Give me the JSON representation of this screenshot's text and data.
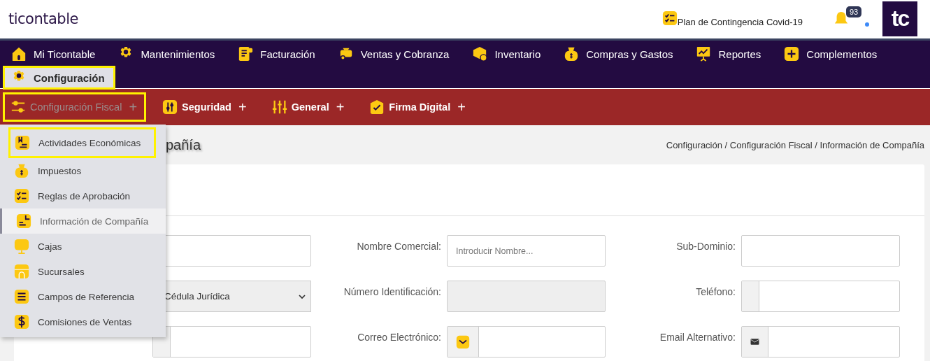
{
  "header": {
    "logo": "ticontable",
    "announcement": "Plan de Contingencia Covid-19",
    "notifications": "93",
    "brand_mark": "tc"
  },
  "main_menu": [
    {
      "label": "Mi Ticontable",
      "selected": false
    },
    {
      "label": "Mantenimientos",
      "selected": false
    },
    {
      "label": "Facturación",
      "selected": false
    },
    {
      "label": "Ventas y Cobranza",
      "selected": false
    },
    {
      "label": "Inventario",
      "selected": false
    },
    {
      "label": "Compras y Gastos",
      "selected": false
    },
    {
      "label": "Reportes",
      "selected": false
    },
    {
      "label": "Complementos",
      "selected": false
    },
    {
      "label": "Configuración",
      "selected": true
    }
  ],
  "sub_menu": [
    {
      "label": "Configuración Fiscal",
      "expander": "+",
      "selected": true
    },
    {
      "label": "Seguridad",
      "expander": "+",
      "selected": false
    },
    {
      "label": "General",
      "expander": "+",
      "selected": false
    },
    {
      "label": "Firma Digital",
      "expander": "+",
      "selected": false
    }
  ],
  "dropdown": [
    {
      "label": "Actividades Económicas",
      "highlighted": true,
      "selected": false
    },
    {
      "label": "Impuestos",
      "highlighted": false,
      "selected": false
    },
    {
      "label": "Reglas de Aprobación",
      "highlighted": false,
      "selected": false
    },
    {
      "label": "Información de Compañía",
      "highlighted": false,
      "selected": true
    },
    {
      "label": "Cajas",
      "highlighted": false,
      "selected": false
    },
    {
      "label": "Sucursales",
      "highlighted": false,
      "selected": false
    },
    {
      "label": "Campos de Referencia",
      "highlighted": false,
      "selected": false
    },
    {
      "label": "Comisiones de Ventas",
      "highlighted": false,
      "selected": false
    }
  ],
  "page": {
    "title": "pañía",
    "breadcrumb": "Configuración / Configuración Fiscal / Información de Compañía"
  },
  "form": {
    "rows": [
      [
        {
          "kind": "text"
        },
        {
          "label": "Nombre Comercial:",
          "kind": "text",
          "placeholder": "Introducir Nombre..."
        },
        {
          "label": "Sub-Dominio:",
          "kind": "text"
        }
      ],
      [
        {
          "kind": "select",
          "value": "Cédula Jurídica"
        },
        {
          "label": "Número Identificación:",
          "kind": "text",
          "disabled": true
        },
        {
          "label": "Teléfono:",
          "kind": "phone"
        }
      ],
      [
        {
          "kind": "phone"
        },
        {
          "label": "Correo Electrónico:",
          "kind": "mail"
        },
        {
          "label": "Email Alternativo:",
          "kind": "mail-alt"
        }
      ]
    ]
  }
}
